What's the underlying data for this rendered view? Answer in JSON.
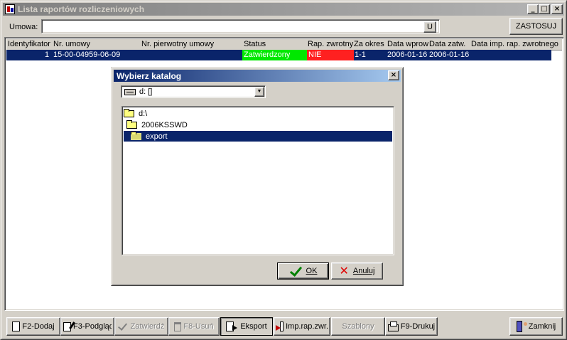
{
  "window": {
    "title": "Lista raportów rozliczeniowych",
    "minimize": "_",
    "maximize": "□",
    "close": "×"
  },
  "filter": {
    "label": "Umowa:",
    "value": "",
    "u_button": "U",
    "apply_button": "ZASTOSUJ"
  },
  "grid": {
    "columns": [
      "Identyfikator",
      "Nr. umowy",
      "Nr. pierwotny umowy",
      "Status",
      "Rap. zwrotny",
      "Za okres",
      "Data wprow",
      "Data zatw.",
      "Data imp. rap. zwrotnego"
    ],
    "rows": [
      {
        "identyfikator": "1",
        "nr_umowy": "15-00-04959-06-09",
        "nr_pierwotny": "",
        "status": "Zatwierdzony",
        "rap_zwrotny": "NIE",
        "za_okres": "1-1",
        "data_wprow": "2006-01-16",
        "data_zatw": "2006-01-16",
        "data_imp": ""
      }
    ],
    "colors": {
      "selected_row": "#0a246a",
      "status_ok": "#00e800",
      "rap_no": "#ff2020"
    }
  },
  "toolbar": {
    "buttons": [
      {
        "label": "F2-Dodaj",
        "icon": "new-document-icon",
        "enabled": true
      },
      {
        "label": "F3-Podgląd",
        "icon": "edit-document-icon",
        "enabled": true
      },
      {
        "label": "Zatwierdź",
        "icon": "checkmark-icon",
        "enabled": false
      },
      {
        "label": "F8-Usuń",
        "icon": "trash-icon",
        "enabled": false
      },
      {
        "label": "Eksport",
        "icon": "export-icon",
        "enabled": true
      },
      {
        "label": "Imp.rap.zwr.",
        "icon": "import-icon",
        "enabled": true
      },
      {
        "label": "Szablony",
        "icon": "",
        "enabled": false
      },
      {
        "label": "F9-Drukuj",
        "icon": "printer-icon",
        "enabled": true
      },
      {
        "label": "Zamknij",
        "icon": "exit-door-icon",
        "enabled": true
      }
    ]
  },
  "dialog": {
    "title": "Wybierz katalog",
    "close": "×",
    "drive": "d: []",
    "folders": [
      {
        "name": "d:\\",
        "selected": false
      },
      {
        "name": "2006KSSWD",
        "selected": false
      },
      {
        "name": "export",
        "selected": true
      }
    ],
    "ok_label": "OK",
    "cancel_label": "Anuluj"
  }
}
